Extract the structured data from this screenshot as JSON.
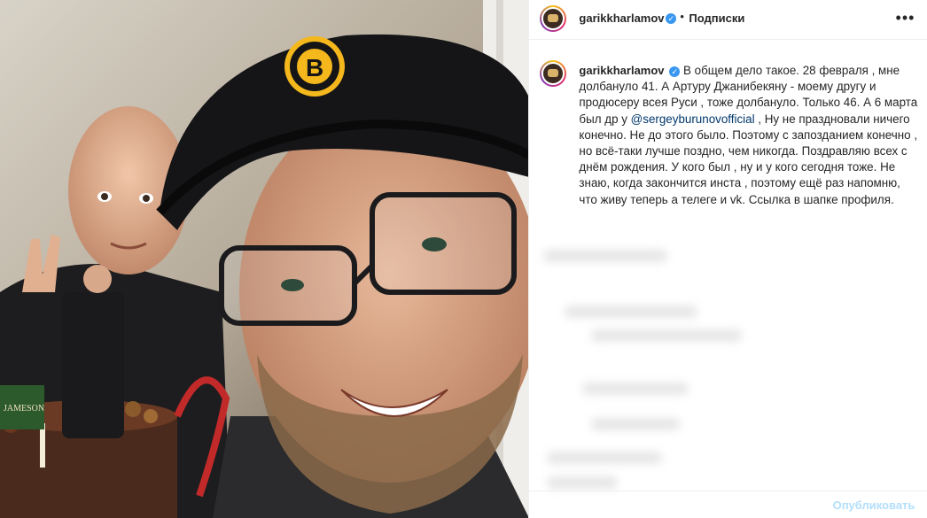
{
  "header": {
    "username": "garikkharlamov",
    "verified_icon": "✓",
    "separator": "•",
    "follow_label": "Подписки",
    "more_icon": "•••"
  },
  "caption": {
    "username": "garikkharlamov",
    "text_before": "В общем дело такое. 28 февраля , мне долбануло 41. А Артуру Джанибекяну - моему другу и продюсеру всея Руси , тоже долбануло. Только 46. А 6 марта был др у ",
    "mention": "@sergeyburunovofficial",
    "text_after": " , Ну не праздновали ничего конечно. Не до этого было. Поэтому с запозданием конечно , но всё-таки лучше поздно, чем никогда. Поздравляю всех с днём рождения. У кого был , ну и у кого сегодня тоже. Не знаю, когда закончится инста , поэтому ещё раз напомню, что живу теперь а телеге и vk. Ссылка в шапке профиля."
  },
  "photo": {
    "cap_logo_letter": "B",
    "bottle_label": "JAMESON"
  },
  "footer": {
    "publish_label": "Опубликовать"
  },
  "colors": {
    "accent": "#3897f0",
    "publish_disabled": "#b2dffc",
    "mention": "#00376b"
  }
}
